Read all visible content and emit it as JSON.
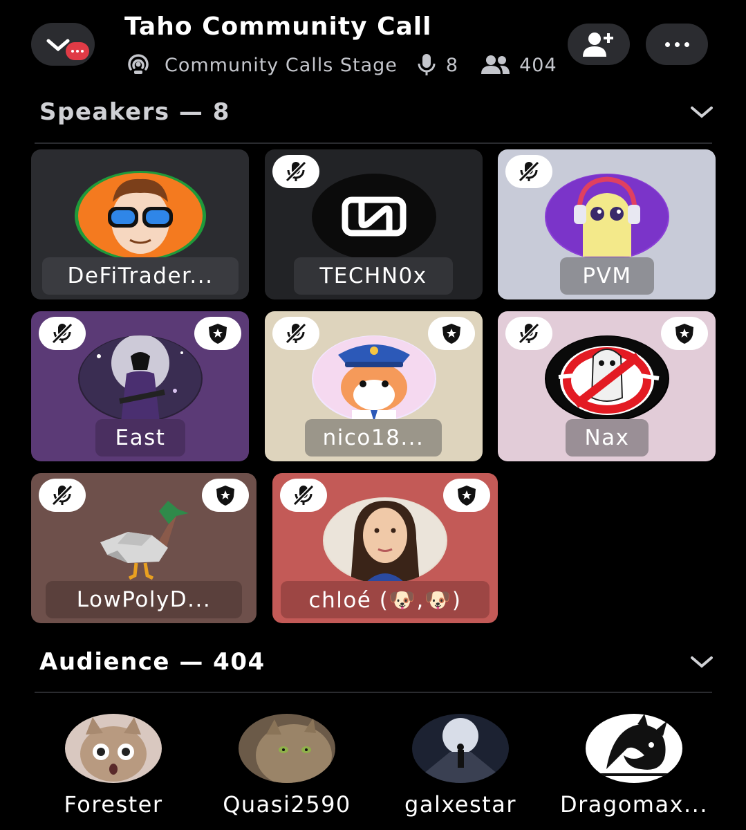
{
  "header": {
    "title": "Taho Community Call",
    "stage_name": "Community Calls Stage",
    "speaker_count": "8",
    "listener_count": "404"
  },
  "speakers_section": {
    "label": "Speakers — 8"
  },
  "speakers": [
    {
      "name": "DeFiTrader...",
      "muted": false,
      "moderator": false,
      "bg": "#2b2c30",
      "pill": "#3a3b40"
    },
    {
      "name": "TECHN0x",
      "muted": true,
      "moderator": false,
      "bg": "#222326",
      "pill": "#333438"
    },
    {
      "name": "PVM",
      "muted": true,
      "moderator": false,
      "bg": "#c8cbd8",
      "pill": "#8f9096"
    },
    {
      "name": "East",
      "muted": true,
      "moderator": true,
      "bg": "#5b3a76",
      "pill": "#4a2f60"
    },
    {
      "name": "nico18...",
      "muted": true,
      "moderator": true,
      "bg": "#ded4bd",
      "pill": "#9b968a"
    },
    {
      "name": "Nax",
      "muted": true,
      "moderator": true,
      "bg": "#e2ccd8",
      "pill": "#9a8f96"
    },
    {
      "name": "LowPolyD...",
      "muted": true,
      "moderator": true,
      "bg": "#6e504b",
      "pill": "#5a403c"
    },
    {
      "name": "chloé (🐶,🐶)",
      "muted": true,
      "moderator": true,
      "bg": "#c35a57",
      "pill": "#9d4644"
    }
  ],
  "audience_section": {
    "label": "Audience — 404"
  },
  "audience": [
    {
      "name": "Forester"
    },
    {
      "name": "Quasi2590"
    },
    {
      "name": "galxestar"
    },
    {
      "name": "Dragomax..."
    }
  ],
  "icons": {
    "leave": "chevron-down-icon",
    "invite": "add-user-icon",
    "more": "more-icon",
    "stage": "stage-icon",
    "mic": "microphone-icon",
    "people": "people-icon",
    "muted": "muted-microphone-icon",
    "moderator": "shield-star-icon"
  },
  "colors": {
    "background": "#000000",
    "accent_red": "#e03b46",
    "secondary_text": "#c4c6cc"
  }
}
